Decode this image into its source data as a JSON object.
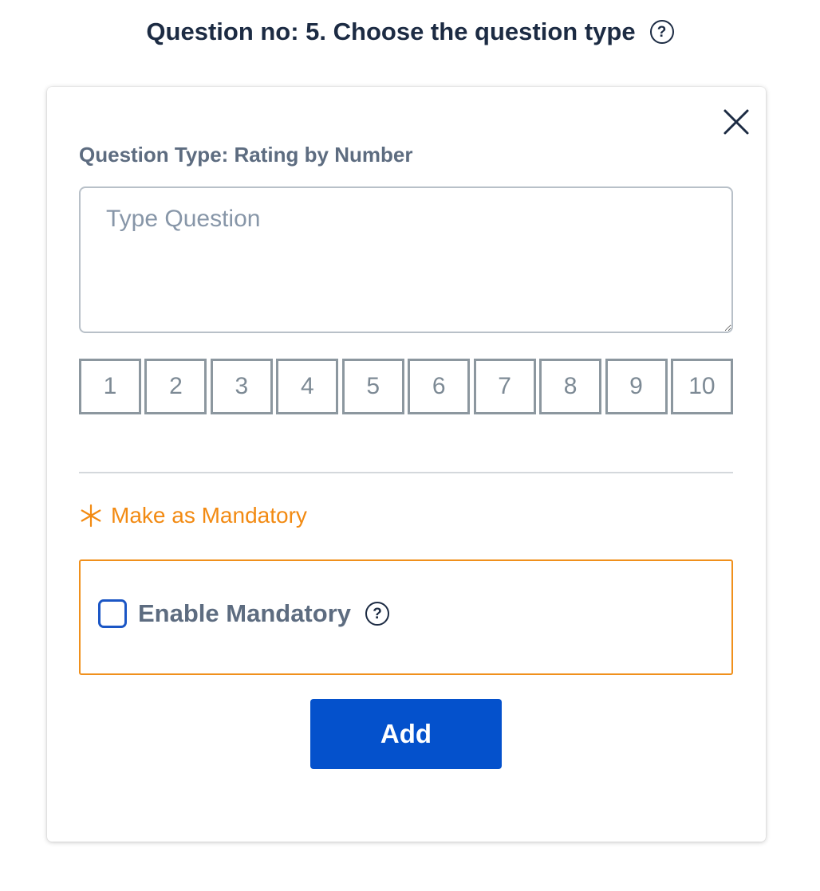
{
  "header": {
    "title": "Question no: 5. Choose the question type",
    "help_glyph": "?"
  },
  "card": {
    "type_label": "Question Type: Rating by Number",
    "question_placeholder": "Type Question",
    "question_value": "",
    "rating_options": [
      "1",
      "2",
      "3",
      "4",
      "5",
      "6",
      "7",
      "8",
      "9",
      "10"
    ],
    "mandatory_heading": "Make as Mandatory",
    "enable_mandatory_label": "Enable Mandatory",
    "enable_mandatory_checked": false,
    "enable_help_glyph": "?",
    "add_label": "Add"
  },
  "icons": {
    "close": "close-icon",
    "help": "question-circle-icon",
    "asterisk": "asterisk-icon"
  },
  "colors": {
    "title": "#1c2b43",
    "label": "#5d6c80",
    "accent_orange": "#f28a12",
    "primary_blue": "#0451cc",
    "checkbox_border": "#1b56c5"
  }
}
